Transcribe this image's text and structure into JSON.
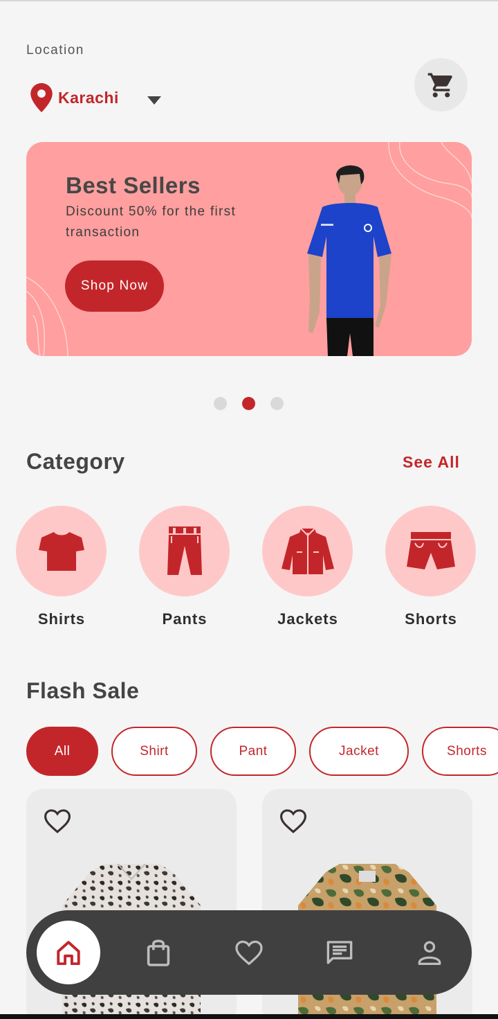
{
  "location": {
    "label": "Location",
    "city": "Karachi"
  },
  "banner": {
    "title": "Best Sellers",
    "subtitle": "Discount 50% for the first transaction",
    "button": "Shop Now",
    "background": "#ff9f9f"
  },
  "carousel": {
    "total": 3,
    "active": 2
  },
  "category": {
    "title": "Category",
    "see_all": "See All",
    "items": [
      {
        "label": "Shirts",
        "icon": "shirt-icon"
      },
      {
        "label": "Pants",
        "icon": "pants-icon"
      },
      {
        "label": "Jackets",
        "icon": "jacket-icon"
      },
      {
        "label": "Shorts",
        "icon": "shorts-icon"
      }
    ]
  },
  "flash_sale": {
    "title": "Flash Sale",
    "filters": [
      "All",
      "Shirt",
      "Pant",
      "Jacket",
      "Shorts"
    ],
    "active_filter": "All"
  },
  "nav": [
    "home-icon",
    "bag-icon",
    "heart-icon",
    "chat-icon",
    "profile-icon"
  ],
  "colors": {
    "accent": "#c3262a",
    "light_accent": "#ffc8c8",
    "nav_bg": "#404040",
    "page_bg": "#f5f5f5"
  }
}
